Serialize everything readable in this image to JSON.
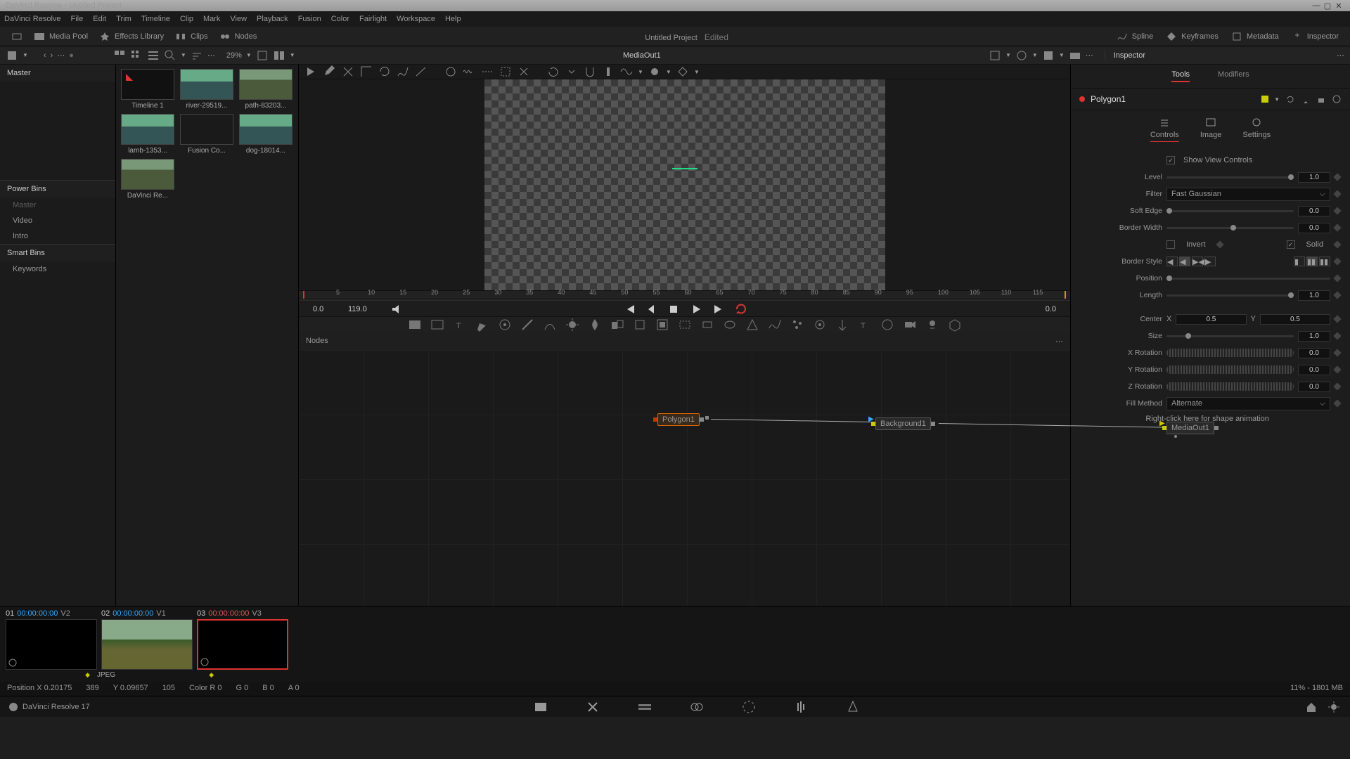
{
  "titlebar": {
    "text": "DaVinci Resolve - Untitled Project"
  },
  "menu": [
    "DaVinci Resolve",
    "File",
    "Edit",
    "Trim",
    "Timeline",
    "Clip",
    "Mark",
    "View",
    "Playback",
    "Fusion",
    "Color",
    "Fairlight",
    "Workspace",
    "Help"
  ],
  "toolbar": {
    "media_pool": "Media Pool",
    "effects": "Effects Library",
    "clips": "Clips",
    "nodes": "Nodes",
    "project": "Untitled Project",
    "edited": "Edited",
    "spline": "Spline",
    "keyframes": "Keyframes",
    "metadata": "Metadata",
    "inspector": "Inspector"
  },
  "subbar": {
    "zoom": "29%",
    "viewer_name": "MediaOut1"
  },
  "leftpanel": {
    "master": "Master",
    "powerbins": "Power Bins",
    "powerbins_items": [
      "Master",
      "Video",
      "Intro"
    ],
    "smartbins": "Smart Bins",
    "smartbins_items": [
      "Keywords"
    ]
  },
  "thumbs": [
    {
      "label": "Timeline 1",
      "kind": "timeline"
    },
    {
      "label": "river-29519...",
      "kind": "landscape"
    },
    {
      "label": "path-83203...",
      "kind": "path"
    },
    {
      "label": "lamb-1353...",
      "kind": "landscape"
    },
    {
      "label": "Fusion Co...",
      "kind": "composite"
    },
    {
      "label": "dog-18014...",
      "kind": "landscape"
    },
    {
      "label": "DaVinci Re...",
      "kind": "path"
    }
  ],
  "ruler_ticks": [
    "5",
    "10",
    "15",
    "20",
    "25",
    "30",
    "35",
    "40",
    "45",
    "50",
    "55",
    "60",
    "65",
    "70",
    "75",
    "80",
    "85",
    "90",
    "95",
    "100",
    "105",
    "110",
    "115"
  ],
  "transport": {
    "in": "0.0",
    "dur": "119.0",
    "out": "0.0"
  },
  "nodes_panel": {
    "title": "Nodes"
  },
  "graph": {
    "polygon": "Polygon1",
    "background": "Background1",
    "mediaout": "MediaOut1"
  },
  "clips": [
    {
      "idx": "01",
      "tc": "00:00:00:00",
      "trk": "V2",
      "tcclass": "tcv",
      "active": false,
      "img": ""
    },
    {
      "idx": "02",
      "tc": "00:00:00:00",
      "trk": "V1",
      "tcclass": "tcv",
      "active": false,
      "img": "land"
    },
    {
      "idx": "03",
      "tc": "00:00:00:00",
      "trk": "V3",
      "tcclass": "tcr",
      "active": true,
      "img": ""
    }
  ],
  "clip_format": "JPEG",
  "statusbar": {
    "pos": "Position X 0.20175",
    "posx": "389",
    "posy": "Y 0.09657",
    "posyv": "105",
    "color": "Color R 0",
    "g": "G 0",
    "b": "B 0",
    "a": "A 0",
    "right": "11% - 1801 MB"
  },
  "inspector": {
    "title": "Inspector",
    "tabs": {
      "tools": "Tools",
      "modifiers": "Modifiers"
    },
    "node_name": "Polygon1",
    "subtabs": {
      "controls": "Controls",
      "image": "Image",
      "settings": "Settings"
    },
    "show_view": "Show View Controls",
    "props": {
      "level": {
        "label": "Level",
        "val": "1.0"
      },
      "filter": {
        "label": "Filter",
        "val": "Fast Gaussian"
      },
      "softedge": {
        "label": "Soft Edge",
        "val": "0.0"
      },
      "borderwidth": {
        "label": "Border Width",
        "val": "0.0"
      },
      "invert": {
        "label": "Invert",
        "solid": "Solid"
      },
      "borderstyle": {
        "label": "Border Style"
      },
      "position": {
        "label": "Position"
      },
      "length": {
        "label": "Length",
        "val": "1.0"
      },
      "center": {
        "label": "Center",
        "x_lbl": "X",
        "x": "0.5",
        "y_lbl": "Y",
        "y": "0.5"
      },
      "size": {
        "label": "Size",
        "val": "1.0"
      },
      "xrot": {
        "label": "X Rotation",
        "val": "0.0"
      },
      "yrot": {
        "label": "Y Rotation",
        "val": "0.0"
      },
      "zrot": {
        "label": "Z Rotation",
        "val": "0.0"
      },
      "fill": {
        "label": "Fill Method",
        "val": "Alternate"
      },
      "hint": "Right-click here for shape animation"
    }
  },
  "pagebar": {
    "app": "DaVinci Resolve 17"
  }
}
